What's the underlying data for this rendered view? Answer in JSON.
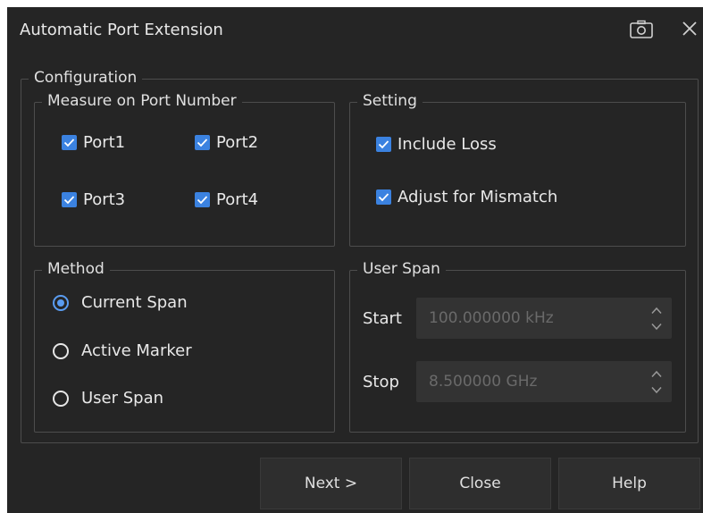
{
  "dialog": {
    "title": "Automatic Port Extension",
    "icons": {
      "screenshot": "camera-icon",
      "close": "close-icon"
    }
  },
  "configuration": {
    "label": "Configuration",
    "measure": {
      "label": "Measure on Port Number",
      "ports": [
        {
          "label": "Port1",
          "checked": true
        },
        {
          "label": "Port2",
          "checked": true
        },
        {
          "label": "Port3",
          "checked": true
        },
        {
          "label": "Port4",
          "checked": true
        }
      ]
    },
    "setting": {
      "label": "Setting",
      "options": [
        {
          "label": "Include Loss",
          "checked": true
        },
        {
          "label": "Adjust for Mismatch",
          "checked": true
        }
      ]
    },
    "method": {
      "label": "Method",
      "options": [
        {
          "label": "Current Span",
          "selected": true
        },
        {
          "label": "Active Marker",
          "selected": false
        },
        {
          "label": "User Span",
          "selected": false
        }
      ]
    },
    "user_span": {
      "label": "User Span",
      "start": {
        "label": "Start",
        "value": "100.000000 kHz"
      },
      "stop": {
        "label": "Stop",
        "value": "8.500000 GHz"
      }
    }
  },
  "buttons": {
    "next": "Next >",
    "close": "Close",
    "help": "Help"
  },
  "colors": {
    "background": "#252525",
    "accent": "#3b82e0",
    "border": "#4d4d4d",
    "disabled_text": "#6a6a6a"
  }
}
